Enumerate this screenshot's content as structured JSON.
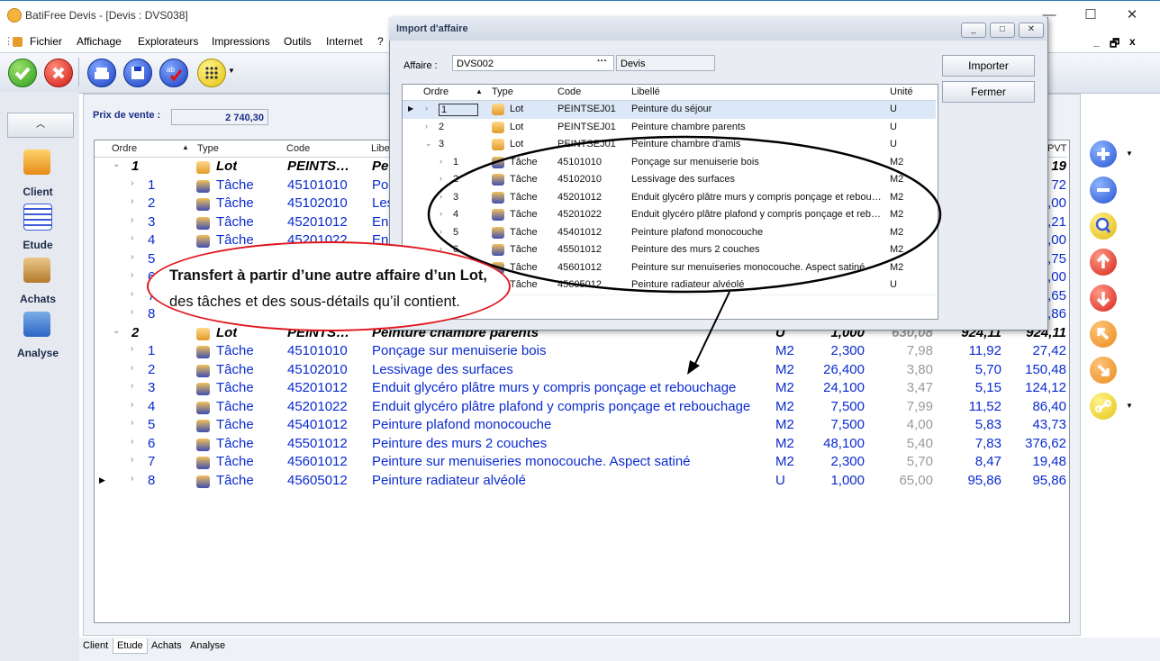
{
  "window": {
    "title": "BatiFree Devis - [Devis : DVS038]",
    "controls": [
      "—",
      "☐",
      "✕"
    ]
  },
  "menu": [
    "Fichier",
    "Affichage",
    "Explorateurs",
    "Impressions",
    "Outils",
    "Internet",
    "?"
  ],
  "mdi_controls": [
    "_",
    "🗗",
    "x"
  ],
  "nav": {
    "items": [
      "Client",
      "Etude",
      "Achats",
      "Analyse"
    ]
  },
  "main": {
    "price_label": "Prix de vente :",
    "price_value": "2 740,30",
    "columns": [
      "Ordre",
      "Type",
      "Code",
      "Libe",
      "PVT"
    ],
    "top_rows": [
      {
        "ordre": "1",
        "type": "Lot",
        "code": "PEINTS…",
        "libelle": "Pe",
        "pvt": "19"
      },
      {
        "ordre": "1",
        "type": "Tâche",
        "code": "45101010",
        "libelle": "Po",
        "pvt": "72"
      },
      {
        "ordre": "2",
        "type": "Tâche",
        "code": "45102010",
        "libelle": "Les",
        "pvt": ",00"
      },
      {
        "ordre": "3",
        "type": "Tâche",
        "code": "45201012",
        "libelle": "En",
        "pvt": ",21"
      },
      {
        "ordre": "4",
        "type": "Tâche",
        "code": "45201022",
        "libelle": "En",
        "pvt": ",00"
      },
      {
        "ordre": "5",
        "pvt": ",75"
      },
      {
        "ordre": "6",
        "pvt": ",00"
      },
      {
        "ordre": "7",
        "pvt": ",65"
      },
      {
        "ordre": "8",
        "pvt": ",86"
      }
    ],
    "lot2": {
      "ordre": "2",
      "type": "Lot",
      "code": "PEINTS…",
      "libelle": "Peinture chambre parents",
      "unite": "U",
      "qte": "1,000",
      "pu": "630,08",
      "pv": "924,11",
      "pvt": "924,11"
    },
    "rows": [
      {
        "ordre": "1",
        "type": "Tâche",
        "code": "45101010",
        "libelle": "Ponçage sur menuiserie bois",
        "unite": "M2",
        "qte": "2,300",
        "pu": "7,98",
        "pv": "11,92",
        "pvt": "27,42"
      },
      {
        "ordre": "2",
        "type": "Tâche",
        "code": "45102010",
        "libelle": "Lessivage des surfaces",
        "unite": "M2",
        "qte": "26,400",
        "pu": "3,80",
        "pv": "5,70",
        "pvt": "150,48"
      },
      {
        "ordre": "3",
        "type": "Tâche",
        "code": "45201012",
        "libelle": "Enduit glycéro plâtre murs y compris ponçage et rebouchage",
        "unite": "M2",
        "qte": "24,100",
        "pu": "3,47",
        "pv": "5,15",
        "pvt": "124,12"
      },
      {
        "ordre": "4",
        "type": "Tâche",
        "code": "45201022",
        "libelle": "Enduit glycéro plâtre plafond y compris ponçage et rebouchage",
        "unite": "M2",
        "qte": "7,500",
        "pu": "7,99",
        "pv": "11,52",
        "pvt": "86,40"
      },
      {
        "ordre": "5",
        "type": "Tâche",
        "code": "45401012",
        "libelle": "Peinture plafond monocouche",
        "unite": "M2",
        "qte": "7,500",
        "pu": "4,00",
        "pv": "5,83",
        "pvt": "43,73"
      },
      {
        "ordre": "6",
        "type": "Tâche",
        "code": "45501012",
        "libelle": "Peinture des murs 2 couches",
        "unite": "M2",
        "qte": "48,100",
        "pu": "5,40",
        "pv": "7,83",
        "pvt": "376,62"
      },
      {
        "ordre": "7",
        "type": "Tâche",
        "code": "45601012",
        "libelle": "Peinture sur menuiseries monocouche. Aspect satiné",
        "unite": "M2",
        "qte": "2,300",
        "pu": "5,70",
        "pv": "8,47",
        "pvt": "19,48"
      },
      {
        "ordre": "8",
        "type": "Tâche",
        "code": "45605012",
        "libelle": "Peinture radiateur alvéolé",
        "unite": "U",
        "qte": "1,000",
        "pu": "65,00",
        "pv": "95,86",
        "pvt": "95,86"
      }
    ]
  },
  "tabs": [
    "Client",
    "Etude",
    "Achats",
    "Analyse"
  ],
  "dialog": {
    "title": "Import d'affaire",
    "affaire_label": "Affaire :",
    "affaire_value": "DVS002",
    "affaire_browse": "···",
    "affaire_desc": "Devis",
    "importer": "Importer",
    "fermer": "Fermer",
    "columns": [
      "Ordre",
      "Type",
      "Code",
      "Libellé",
      "Unité"
    ],
    "rows": [
      {
        "ordre": "1",
        "type": "Lot",
        "code": "PEINTSEJ01",
        "libelle": "Peinture du séjour",
        "unite": "U"
      },
      {
        "ordre": "2",
        "type": "Lot",
        "code": "PEINTSEJ01",
        "libelle": "Peinture chambre parents",
        "unite": "U"
      },
      {
        "ordre": "3",
        "type": "Lot",
        "code": "PEINTSEJ01",
        "libelle": "Peinture chambre d'amis",
        "unite": "U"
      },
      {
        "ordre": "1",
        "type": "Tâche",
        "code": "45101010",
        "libelle": "Ponçage sur menuiserie bois",
        "unite": "M2"
      },
      {
        "ordre": "2",
        "type": "Tâche",
        "code": "45102010",
        "libelle": "Lessivage des surfaces",
        "unite": "M2"
      },
      {
        "ordre": "3",
        "type": "Tâche",
        "code": "45201012",
        "libelle": "Enduit glycéro plâtre murs y compris ponçage et rebou…",
        "unite": "M2"
      },
      {
        "ordre": "4",
        "type": "Tâche",
        "code": "45201022",
        "libelle": "Enduit glycéro plâtre plafond y compris ponçage et reb…",
        "unite": "M2"
      },
      {
        "ordre": "5",
        "type": "Tâche",
        "code": "45401012",
        "libelle": "Peinture plafond monocouche",
        "unite": "M2"
      },
      {
        "ordre": "6",
        "type": "Tâche",
        "code": "45501012",
        "libelle": "Peinture des murs 2 couches",
        "unite": "M2"
      },
      {
        "ordre": "7",
        "type": "Tâche",
        "code": "45601012",
        "libelle": "Peinture sur menuiseries monocouche. Aspect satiné",
        "unite": "M2"
      },
      {
        "ordre": "8",
        "type": "Tâche",
        "code": "45605012",
        "libelle": "Peinture radiateur alvéolé",
        "unite": "U"
      }
    ]
  },
  "annotation": {
    "line1": "Transfert à partir d’une autre affaire d’un Lot,",
    "line2": "des tâches et des sous-détails qu’il contient."
  },
  "colors": {
    "accent_blue": "#0a2bd0",
    "annotation_red": "#e0161e",
    "selected_row": "#dce8f8"
  }
}
